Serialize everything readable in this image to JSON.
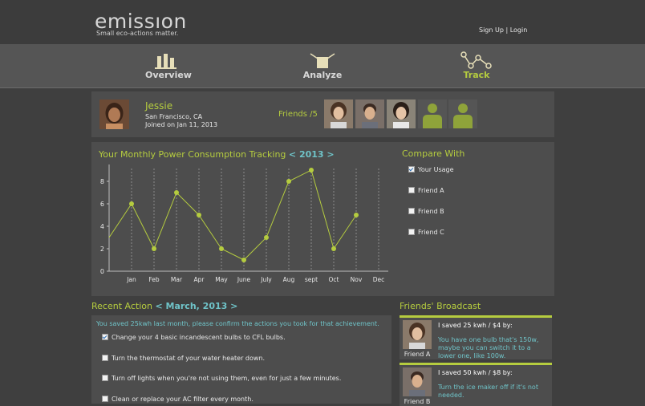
{
  "header": {
    "logo": "emissıon",
    "tagline": "Small eco-actions matter.",
    "signup": "Sign Up",
    "separator": " | ",
    "login": "Login"
  },
  "nav": [
    {
      "label": "Overview",
      "icon": "bar-chart-icon",
      "active": false
    },
    {
      "label": "Analyze",
      "icon": "analyze-icon",
      "active": false
    },
    {
      "label": "Track",
      "icon": "line-graph-icon",
      "active": true
    }
  ],
  "profile": {
    "name": "Jessie",
    "location": "San Francisco, CA",
    "joined": "Joined on Jan 11, 2013",
    "friends_label": "Friends /5"
  },
  "chart_panel": {
    "title": "Your Monthly Power Consumption Tracking ",
    "year": "< 2013 >"
  },
  "compare": {
    "title": "Compare With",
    "options": [
      {
        "label": "Your Usage",
        "checked": true
      },
      {
        "label": "Friend A",
        "checked": false
      },
      {
        "label": "Friend B",
        "checked": false
      },
      {
        "label": "Friend C",
        "checked": false
      }
    ]
  },
  "chart_data": {
    "type": "line",
    "categories": [
      "Jan",
      "Feb",
      "Mar",
      "Apr",
      "May",
      "June",
      "July",
      "Aug",
      "sept",
      "Oct",
      "Nov",
      "Dec"
    ],
    "values": [
      6,
      2,
      7,
      5,
      2,
      1,
      3,
      8,
      9,
      2,
      5,
      null
    ],
    "start_value": 3,
    "yticks": [
      0,
      2,
      4,
      6,
      8
    ],
    "ylim": [
      0,
      9.5
    ],
    "color": "#b5cc3f",
    "grid": "vertical dotted"
  },
  "recent": {
    "title": "Recent Action ",
    "month": "< March, 2013 >",
    "message": "You saved 25kwh last month, please confirm the actions you took for that achievement.",
    "actions": [
      {
        "label": "Change your 4 basic incandescent bulbs to CFL bulbs.",
        "checked": true
      },
      {
        "label": "Turn the thermostat of your water heater down.",
        "checked": false
      },
      {
        "label": "Turn off lights when you're not using them, even for just a few minutes.",
        "checked": false
      },
      {
        "label": "Clean or replace your AC filter every month.",
        "checked": false
      }
    ]
  },
  "broadcast": {
    "title": "Friends' Broadcast",
    "items": [
      {
        "friend": "Friend A",
        "headline": "I saved 25 kwh / $4 by:",
        "text": "You have one bulb that's 150w, maybe you can switch it to a lower one, like 100w."
      },
      {
        "friend": "Friend B",
        "headline": "I saved 50 kwh / $8 by:",
        "text": "Turn the ice maker off if it's not needed."
      }
    ]
  }
}
